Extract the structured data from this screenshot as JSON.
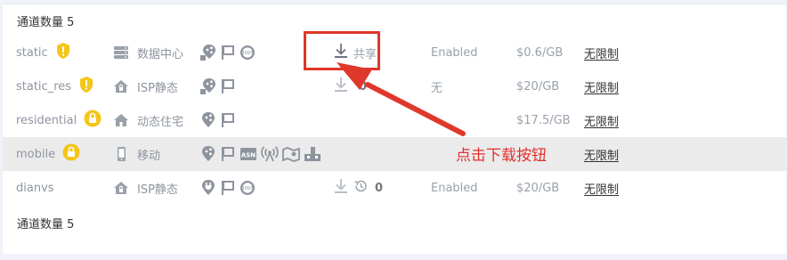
{
  "channel_count_label": "通道数量 5",
  "rows": [
    {
      "name": "static",
      "type": "数据中心",
      "download": "共享",
      "status": "Enabled",
      "price": "$0.6/GB",
      "limit": "无限制"
    },
    {
      "name": "static_res",
      "type": "ISP静态",
      "download": "0",
      "status": "无",
      "price": "$20/GB",
      "limit": "无限制"
    },
    {
      "name": "residential",
      "type": "动态住宅",
      "download": "",
      "status": "",
      "price": "$17.5/GB",
      "limit": "无限制"
    },
    {
      "name": "mobile",
      "type": "移动",
      "download": "",
      "status": "",
      "price": "",
      "limit": "无限制"
    },
    {
      "name": "dianvs",
      "type": "ISP静态",
      "download": "0",
      "status": "Enabled",
      "price": "$20/GB",
      "limit": "无限制"
    }
  ],
  "annotation": {
    "text": "点击下载按钮",
    "color": "#e0372b"
  },
  "colors": {
    "warn_badge": "#f5c518",
    "highlight_row": "#ebebeb",
    "icon_gray": "#9aa1ab"
  },
  "icons": {
    "badges": [
      "exclamation-shield-icon",
      "exclamation-shield-icon",
      "lock-icon",
      "lock-icon",
      ""
    ],
    "types": [
      "server-icon",
      "home-lock-icon",
      "home-icon",
      "phone-icon",
      "home-lock-icon"
    ]
  }
}
